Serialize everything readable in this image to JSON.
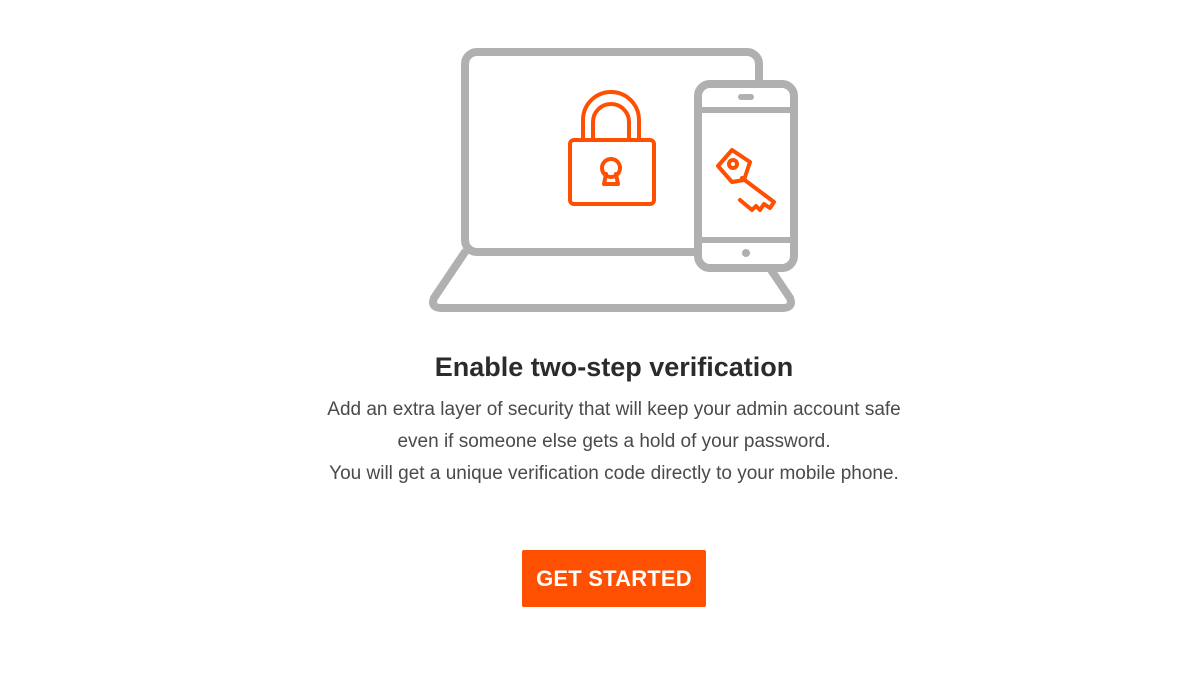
{
  "verification": {
    "title": "Enable two-step verification",
    "description_lines": [
      "Add an extra layer of security that will keep your admin account safe",
      "even if someone else gets a hold of your password.",
      "You will get a unique verification code directly to your mobile phone."
    ],
    "cta_label": "GET STARTED"
  },
  "illustration": {
    "icons": [
      "laptop-icon",
      "padlock-icon",
      "smartphone-icon",
      "key-icon"
    ]
  },
  "colors": {
    "accent": "#ff4f00",
    "illustration_gray": "#b0b0b0",
    "title_text": "#2b2b2b",
    "body_text": "#4a4a4a",
    "button_text": "#ffffff"
  }
}
